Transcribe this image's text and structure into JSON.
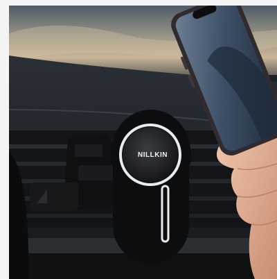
{
  "photo": {
    "description_label": "",
    "product": {
      "brand_logo_text": "NILLKIN"
    },
    "colors": {
      "sky_top": "#5b6572",
      "sky_glow": "#c9b89a",
      "dashboard": "#23272d",
      "phone_frame": "#2f2b2f",
      "phone_screen": "#3b4d63",
      "mount_body": "#141517",
      "mount_ring": "#e9ecef",
      "skin": "#e3b49a"
    }
  }
}
